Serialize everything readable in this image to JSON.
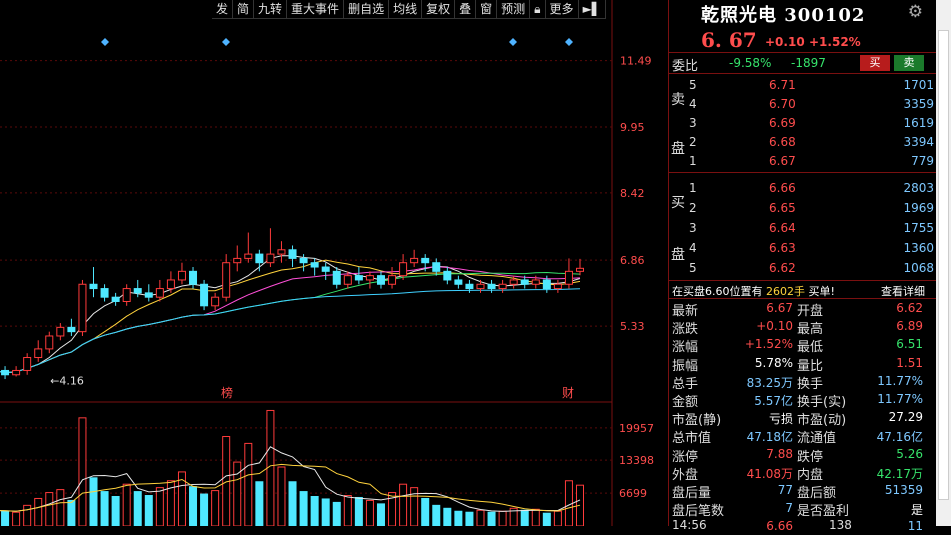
{
  "toolbar": [
    "发",
    "简",
    "九转",
    "重大事件",
    "删自选",
    "均线",
    "复权",
    "叠",
    "窗",
    "预测",
    "更多"
  ],
  "toolbar_icons": [
    "lock-icon",
    "speaker-icon"
  ],
  "stock": {
    "name": "乾照光电 300102",
    "price": "6. 67",
    "change": "+0.10",
    "change_pct": "+1.52%"
  },
  "weibi": {
    "label": "委比",
    "ratio": "-9.58%",
    "diff": "-1897",
    "buy_btn": "买",
    "sell_btn": "卖"
  },
  "sell_side_label": [
    "卖",
    "盘"
  ],
  "buy_side_label": [
    "买",
    "盘"
  ],
  "asks": [
    {
      "level": "5",
      "price": "6.71",
      "vol": "1701"
    },
    {
      "level": "4",
      "price": "6.70",
      "vol": "3359"
    },
    {
      "level": "3",
      "price": "6.69",
      "vol": "1619"
    },
    {
      "level": "2",
      "price": "6.68",
      "vol": "3394"
    },
    {
      "level": "1",
      "price": "6.67",
      "vol": "779"
    }
  ],
  "bids": [
    {
      "level": "1",
      "price": "6.66",
      "vol": "2803"
    },
    {
      "level": "2",
      "price": "6.65",
      "vol": "1969"
    },
    {
      "level": "3",
      "price": "6.64",
      "vol": "1755"
    },
    {
      "level": "4",
      "price": "6.63",
      "vol": "1360"
    },
    {
      "level": "5",
      "price": "6.62",
      "vol": "1068"
    }
  ],
  "info_line": {
    "text_a": "在买盘6.60位置有 ",
    "num": "2602手",
    "text_b": " 买单!",
    "link": "查看详细"
  },
  "stats": [
    {
      "l1": "最新",
      "v1": "6.67",
      "c1": "red",
      "l2": "开盘",
      "v2": "6.62",
      "c2": "red"
    },
    {
      "l1": "涨跌",
      "v1": "+0.10",
      "c1": "red",
      "l2": "最高",
      "v2": "6.89",
      "c2": "red"
    },
    {
      "l1": "涨幅",
      "v1": "+1.52%",
      "c1": "red",
      "l2": "最低",
      "v2": "6.51",
      "c2": "green"
    },
    {
      "l1": "振幅",
      "v1": "5.78%",
      "c1": "white",
      "l2": "量比",
      "v2": "1.51",
      "c2": "red"
    },
    {
      "l1": "总手",
      "v1": "83.25万",
      "c1": "cyan",
      "l2": "换手",
      "v2": "11.77%",
      "c2": "cyan"
    },
    {
      "l1": "金额",
      "v1": "5.57亿",
      "c1": "cyan",
      "l2": "换手(实)",
      "v2": "11.77%",
      "c2": "cyan"
    },
    {
      "l1": "市盈(静)",
      "v1": "亏损",
      "c1": "white",
      "l2": "市盈(动)",
      "v2": "27.29",
      "c2": "white"
    },
    {
      "l1": "总市值",
      "v1": "47.18亿",
      "c1": "cyan",
      "l2": "流通值",
      "v2": "47.16亿",
      "c2": "cyan"
    },
    {
      "l1": "涨停",
      "v1": "7.88",
      "c1": "red",
      "l2": "跌停",
      "v2": "5.26",
      "c2": "green"
    },
    {
      "l1": "外盘",
      "v1": "41.08万",
      "c1": "red",
      "l2": "内盘",
      "v2": "42.17万",
      "c2": "green"
    },
    {
      "l1": "盘后量",
      "v1": "77",
      "c1": "cyan",
      "l2": "盘后额",
      "v2": "51359",
      "c2": "cyan"
    },
    {
      "l1": "盘后笔数",
      "v1": "7",
      "c1": "cyan",
      "l2": "是否盈利",
      "v2": "是",
      "c2": "white"
    }
  ],
  "tail": {
    "time": "14:56",
    "price": "6.66",
    "vol": "138",
    "dir": "11"
  },
  "chart_data": {
    "type": "candlestick",
    "price_ticks": [
      "11.49",
      "9.95",
      "8.42",
      "6.86",
      "5.33"
    ],
    "price_tick_values": [
      11.49,
      9.95,
      8.42,
      6.86,
      5.33
    ],
    "volume_ticks": [
      "19957",
      "13398",
      "6699"
    ],
    "volume_tick_values": [
      19957,
      13398,
      6699
    ],
    "low_label": "←4.16",
    "low_value": 4.16,
    "markers": [
      "榜",
      "财"
    ],
    "price_range": [
      3.8,
      12.2
    ],
    "volume_range": [
      0,
      24000
    ],
    "candles": [
      [
        4.6,
        4.3,
        4.7,
        4.3
      ],
      [
        4.3,
        4.2,
        4.4,
        4.1
      ],
      [
        4.2,
        4.3,
        4.4,
        4.16
      ],
      [
        4.3,
        4.6,
        4.7,
        4.2
      ],
      [
        4.6,
        4.8,
        5.0,
        4.5
      ],
      [
        4.8,
        5.1,
        5.2,
        4.7
      ],
      [
        5.1,
        5.3,
        5.4,
        5.0
      ],
      [
        5.3,
        5.2,
        5.5,
        5.1
      ],
      [
        5.2,
        6.3,
        6.4,
        5.1
      ],
      [
        6.3,
        6.2,
        6.7,
        6.0
      ],
      [
        6.2,
        6.0,
        6.3,
        5.9
      ],
      [
        6.0,
        5.9,
        6.1,
        5.8
      ],
      [
        5.9,
        6.2,
        6.3,
        5.8
      ],
      [
        6.2,
        6.1,
        6.4,
        6.0
      ],
      [
        6.1,
        6.0,
        6.3,
        5.9
      ],
      [
        6.0,
        6.2,
        6.4,
        5.9
      ],
      [
        6.2,
        6.4,
        6.6,
        6.1
      ],
      [
        6.4,
        6.6,
        6.8,
        6.3
      ],
      [
        6.6,
        6.3,
        6.7,
        6.2
      ],
      [
        6.3,
        5.8,
        6.4,
        5.7
      ],
      [
        5.8,
        6.0,
        6.1,
        5.7
      ],
      [
        6.0,
        6.8,
        7.0,
        5.9
      ],
      [
        6.8,
        6.9,
        7.2,
        6.6
      ],
      [
        6.9,
        7.0,
        7.5,
        6.8
      ],
      [
        7.0,
        6.8,
        7.1,
        6.6
      ],
      [
        6.8,
        7.0,
        7.6,
        6.7
      ],
      [
        7.0,
        7.1,
        7.3,
        6.8
      ],
      [
        7.1,
        6.9,
        7.2,
        6.7
      ],
      [
        6.9,
        6.8,
        7.0,
        6.6
      ],
      [
        6.8,
        6.7,
        6.9,
        6.5
      ],
      [
        6.7,
        6.6,
        6.8,
        6.4
      ],
      [
        6.6,
        6.3,
        6.7,
        6.2
      ],
      [
        6.3,
        6.5,
        6.6,
        6.2
      ],
      [
        6.5,
        6.4,
        6.7,
        6.3
      ],
      [
        6.4,
        6.5,
        6.6,
        6.2
      ],
      [
        6.5,
        6.3,
        6.6,
        6.2
      ],
      [
        6.3,
        6.5,
        6.7,
        6.2
      ],
      [
        6.5,
        6.8,
        7.0,
        6.4
      ],
      [
        6.8,
        6.9,
        7.1,
        6.7
      ],
      [
        6.9,
        6.8,
        7.0,
        6.6
      ],
      [
        6.8,
        6.6,
        6.9,
        6.5
      ],
      [
        6.6,
        6.4,
        6.7,
        6.3
      ],
      [
        6.4,
        6.3,
        6.5,
        6.2
      ],
      [
        6.3,
        6.2,
        6.4,
        6.1
      ],
      [
        6.2,
        6.3,
        6.4,
        6.1
      ],
      [
        6.3,
        6.2,
        6.4,
        6.1
      ],
      [
        6.2,
        6.3,
        6.4,
        6.1
      ],
      [
        6.3,
        6.4,
        6.5,
        6.2
      ],
      [
        6.4,
        6.3,
        6.5,
        6.2
      ],
      [
        6.3,
        6.4,
        6.5,
        6.2
      ],
      [
        6.4,
        6.2,
        6.5,
        6.1
      ],
      [
        6.2,
        6.3,
        6.4,
        6.1
      ],
      [
        6.3,
        6.6,
        6.9,
        6.2
      ],
      [
        6.6,
        6.67,
        6.89,
        6.51
      ]
    ],
    "volumes": [
      3200,
      3000,
      2800,
      4200,
      5600,
      6800,
      7400,
      5200,
      22000,
      9800,
      7000,
      6000,
      8500,
      7000,
      6200,
      7800,
      9200,
      11000,
      8000,
      6500,
      7200,
      18200,
      13000,
      16800,
      9000,
      23500,
      12000,
      9000,
      7000,
      6000,
      5500,
      4800,
      6200,
      5800,
      5200,
      4500,
      6800,
      8500,
      7800,
      5600,
      4200,
      3600,
      3000,
      2800,
      3200,
      2800,
      3000,
      3600,
      3200,
      3400,
      2600,
      3000,
      9200,
      8300
    ]
  }
}
